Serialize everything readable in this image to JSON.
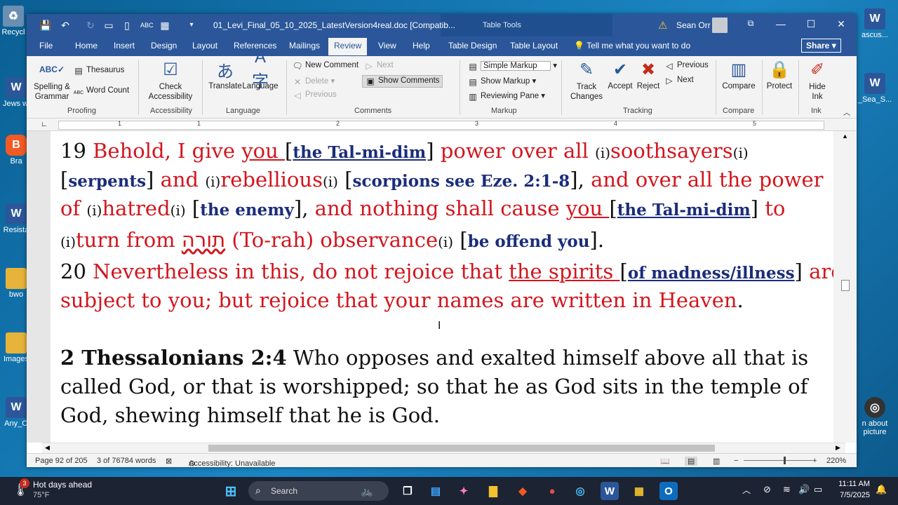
{
  "desktop": {
    "icons": [
      {
        "label": "Recycl",
        "glyph": "♻",
        "color": "#6b8fb3"
      },
      {
        "label": "Jews w belie",
        "glyph": "W",
        "color": "#2b579a"
      },
      {
        "label": "Bra",
        "glyph": "B",
        "color": "#f15a24"
      },
      {
        "label": "Resista",
        "glyph": "W",
        "color": "#2b579a"
      },
      {
        "label": "bwo",
        "glyph": "▇",
        "color": "#e8b33a"
      },
      {
        "label": "Images",
        "glyph": "▇",
        "color": "#e8b33a"
      },
      {
        "label": "Any_O",
        "glyph": "W",
        "color": "#2b579a"
      }
    ],
    "right_icons": [
      {
        "label": "ascus...",
        "glyph": "W",
        "color": "#2b579a"
      },
      {
        "label": "_Sea_S...",
        "glyph": "W",
        "color": "#2b579a"
      },
      {
        "label": "n about picture",
        "glyph": "◎",
        "color": "#333333"
      }
    ]
  },
  "titlebar": {
    "doc_title": "01_Levi_Final_05_10_2025_LatestVersion4real.doc [Compatib...",
    "context_label": "Table Tools",
    "user": "Sean Orr",
    "warning_icon": "warning-icon"
  },
  "tabs": [
    "File",
    "Home",
    "Insert",
    "Design",
    "Layout",
    "References",
    "Mailings",
    "Review",
    "View",
    "Help",
    "Table Design",
    "Table Layout"
  ],
  "active_tab": "Review",
  "tellme": "Tell me what you want to do",
  "share": "Share",
  "ribbon": {
    "proofing": {
      "spelling": "Spelling &\nGrammar",
      "thesaurus": "Thesaurus",
      "word_count": "Word Count",
      "label": "Proofing"
    },
    "accessibility": {
      "check": "Check\nAccessibility",
      "label": "Accessibility"
    },
    "language": {
      "translate": "Translate",
      "language": "Language",
      "label": "Language"
    },
    "comments": {
      "new": "New Comment",
      "delete": "Delete",
      "previous": "Previous",
      "next": "Next",
      "show": "Show Comments",
      "label": "Comments"
    },
    "markup": {
      "simple": "Simple Markup",
      "show": "Show Markup",
      "pane": "Reviewing Pane",
      "label": "Markup"
    },
    "tracking": {
      "track": "Track\nChanges",
      "accept": "Accept",
      "reject": "Reject",
      "previous": "Previous",
      "next": "Next",
      "label": "Tracking"
    },
    "compare": {
      "compare": "Compare",
      "label": "Compare"
    },
    "protect": {
      "protect": "Protect"
    },
    "ink": {
      "hide": "Hide\nInk",
      "label": "Ink"
    }
  },
  "ruler": {
    "numbers": [
      "1",
      "1",
      "2",
      "3",
      "4",
      "5"
    ]
  },
  "document": {
    "line1": {
      "num": "19 ",
      "a": "Behold, I give ",
      "b": "you ",
      "c": "[",
      "d": "the Tal-mi-dim",
      "e": "] ",
      "f": "power over all ",
      "g": "(i)",
      "h": "soothsayers",
      "i": "(i)"
    },
    "line2": {
      "a": "[",
      "b": "serpents",
      "c": "] ",
      "d": "and ",
      "e": "(i)",
      "f": "rebellious",
      "g": "(i)",
      "h": " [",
      "i": "scorpions see Eze. 2:1-8",
      "j": "], ",
      "k": "and over all the power"
    },
    "line3": {
      "a": "of ",
      "b": "(i)",
      "c": "hatred",
      "d": "(i)",
      "e": " [",
      "f": "the enemy",
      "g": "], ",
      "h": "and nothing shall cause ",
      "i": "you ",
      "j": "[",
      "k": "the Tal-mi-dim",
      "l": "] ",
      "m": "to"
    },
    "line4": {
      "a": "(i)",
      "b": "turn from ",
      "c": "תורה",
      "d": " (To-rah) observance",
      "e": "(i)",
      "f": " [",
      "g": "be offend you",
      "h": "]."
    },
    "line5": {
      "num": "20 ",
      "a": "Nevertheless in this, do not rejoice that ",
      "b": "the spirits ",
      "c": "[",
      "d": "of madness/illness",
      "e": "] ",
      "f": "are"
    },
    "line6": {
      "a": "subject to you; but rejoice that your names are written in Heaven",
      "b": "."
    },
    "line7": {
      "ref": "2 Thessalonians 2:4",
      "a": " Who opposes and exalted himself above all that is"
    },
    "line8": {
      "a": "called God, or that is worshipped; so that he as God sits in the temple of"
    },
    "line9": {
      "a": "God, shewing himself that he is God."
    }
  },
  "status": {
    "page": "Page 92 of 205",
    "words": "3 of 76784 words",
    "accessibility": "Accessibility: Unavailable",
    "zoom": "220%"
  },
  "taskbar": {
    "weather_badge": "3",
    "weather_title": "Hot days ahead",
    "weather_temp": "75°F",
    "search": "Search",
    "time": "11:11 AM",
    "date": "7/5/2025"
  }
}
